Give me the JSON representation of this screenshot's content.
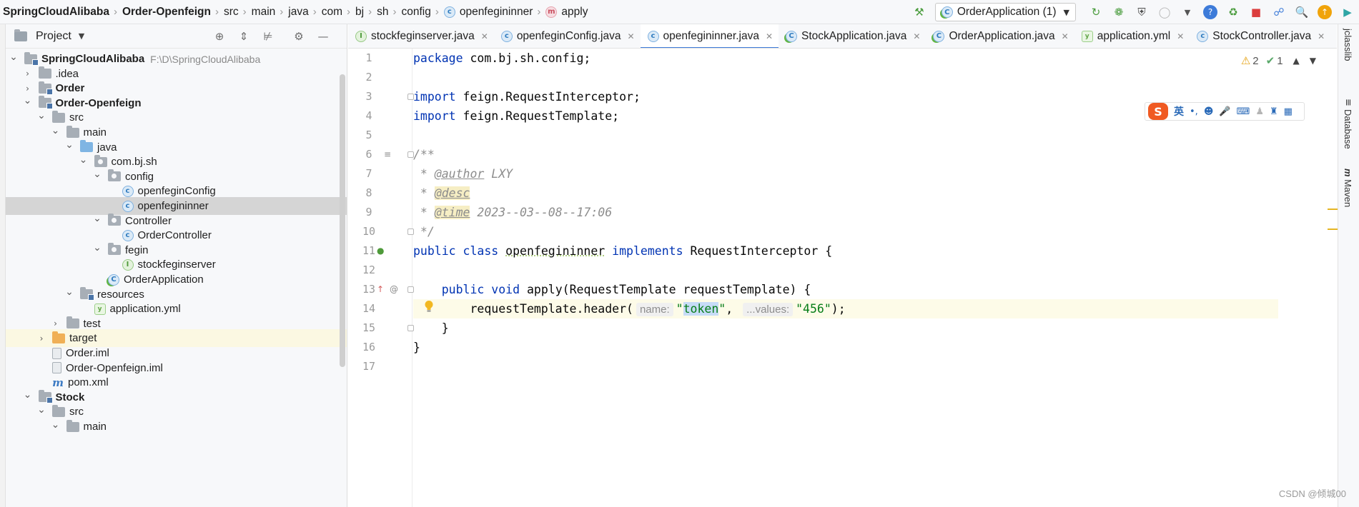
{
  "navbar": {
    "breadcrumbs": [
      {
        "label": "SpringCloudAlibaba",
        "bold": true
      },
      {
        "label": "Order-Openfeign",
        "bold": true
      },
      {
        "label": "src"
      },
      {
        "label": "main"
      },
      {
        "label": "java"
      },
      {
        "label": "com"
      },
      {
        "label": "bj"
      },
      {
        "label": "sh"
      },
      {
        "label": "config"
      },
      {
        "label": "openfegininner",
        "icon": "c"
      },
      {
        "label": "apply",
        "icon": "m"
      }
    ],
    "run_config": "OrderApplication (1)"
  },
  "project_panel": {
    "title": "Project",
    "tree": [
      {
        "label": "SpringCloudAlibaba",
        "bold": true,
        "path": "F:\\D\\SpringCloudAlibaba",
        "indent": 0,
        "chevron": "open",
        "icon": "module"
      },
      {
        "label": ".idea",
        "indent": 1,
        "chevron": "closed",
        "icon": "folder"
      },
      {
        "label": "Order",
        "bold": true,
        "indent": 1,
        "chevron": "closed",
        "icon": "module"
      },
      {
        "label": "Order-Openfeign",
        "bold": true,
        "indent": 1,
        "chevron": "open",
        "icon": "module"
      },
      {
        "label": "src",
        "indent": 2,
        "chevron": "open",
        "icon": "folder"
      },
      {
        "label": "main",
        "indent": 3,
        "chevron": "open",
        "icon": "folder"
      },
      {
        "label": "java",
        "indent": 4,
        "chevron": "open",
        "icon": "folder-blue"
      },
      {
        "label": "com.bj.sh",
        "indent": 5,
        "chevron": "open",
        "icon": "package"
      },
      {
        "label": "config",
        "indent": 6,
        "chevron": "open",
        "icon": "package"
      },
      {
        "label": "openfeginConfig",
        "indent": 7,
        "chevron": "none",
        "icon": "class"
      },
      {
        "label": "openfegininner",
        "indent": 7,
        "chevron": "none",
        "icon": "class",
        "selected": true
      },
      {
        "label": "Controller",
        "indent": 6,
        "chevron": "open",
        "icon": "package"
      },
      {
        "label": "OrderController",
        "indent": 7,
        "chevron": "none",
        "icon": "class"
      },
      {
        "label": "fegin",
        "indent": 6,
        "chevron": "open",
        "icon": "package"
      },
      {
        "label": "stockfeginserver",
        "indent": 7,
        "chevron": "none",
        "icon": "interface"
      },
      {
        "label": "OrderApplication",
        "indent": 6,
        "chevron": "none",
        "icon": "spring-class"
      },
      {
        "label": "resources",
        "indent": 4,
        "chevron": "open",
        "icon": "folder-res"
      },
      {
        "label": "application.yml",
        "indent": 5,
        "chevron": "none",
        "icon": "yml"
      },
      {
        "label": "test",
        "indent": 3,
        "chevron": "closed",
        "icon": "folder"
      },
      {
        "label": "target",
        "indent": 2,
        "chevron": "closed",
        "icon": "folder-orange",
        "highlight": true
      },
      {
        "label": "Order.iml",
        "indent": 2,
        "chevron": "none",
        "icon": "iml"
      },
      {
        "label": "Order-Openfeign.iml",
        "indent": 2,
        "chevron": "none",
        "icon": "iml"
      },
      {
        "label": "pom.xml",
        "indent": 2,
        "chevron": "none",
        "icon": "maven"
      },
      {
        "label": "Stock",
        "bold": true,
        "indent": 1,
        "chevron": "open",
        "icon": "module"
      },
      {
        "label": "src",
        "indent": 2,
        "chevron": "open",
        "icon": "folder"
      },
      {
        "label": "main",
        "indent": 3,
        "chevron": "open",
        "icon": "folder"
      }
    ]
  },
  "editor": {
    "tabs": [
      {
        "label": "stockfeginserver.java",
        "icon": "i"
      },
      {
        "label": "openfeginConfig.java",
        "icon": "c"
      },
      {
        "label": "openfegininner.java",
        "icon": "c",
        "active": true
      },
      {
        "label": "StockApplication.java",
        "icon": "app"
      },
      {
        "label": "OrderApplication.java",
        "icon": "app"
      },
      {
        "label": "application.yml",
        "icon": "yml"
      },
      {
        "label": "StockController.java",
        "icon": "c"
      }
    ],
    "line_numbers": [
      "1",
      "2",
      "3",
      "4",
      "5",
      "6",
      "7",
      "8",
      "9",
      "10",
      "11",
      "12",
      "13",
      "14",
      "15",
      "16",
      "17"
    ],
    "code": {
      "l1_kw": "package",
      "l1_rest": " com.bj.sh.config;",
      "import_kw": "import",
      "l3_rest": " feign.RequestInterceptor;",
      "l4_rest": " feign.RequestTemplate;",
      "l6": "/**",
      "l7_star": " * ",
      "l7_tag": "@author",
      "l7_val": " LXY",
      "l8_star": " * ",
      "l8_tag": "@desc",
      "l9_star": " * ",
      "l9_tag": "@time",
      "l9_val": " 2023--03--08--17:06",
      "l10": " */",
      "l11_kw1": "public",
      "l11_kw2": "class",
      "l11_name": "openfegininner",
      "l11_kw3": "implements",
      "l11_rest": " RequestInterceptor {",
      "l13_indent": "    ",
      "l13_kw1": "public",
      "l13_kw2": "void",
      "l13_rest": " apply(RequestTemplate requestTemplate) {",
      "l14_a": "        requestTemplate.header(",
      "l14_hint1": "name:",
      "l14_q1": "\"",
      "l14_token": "token",
      "l14_q2": "\"",
      "l14_comma": ", ",
      "l14_hint2": "...values:",
      "l14_val": "\"456\"",
      "l14_end": ");",
      "l15": "    }",
      "l16": "}"
    },
    "inspections": {
      "warnings": "2",
      "checks": "1"
    },
    "ime_label": "英"
  },
  "right_strip": {
    "tabs": [
      "jclasslib",
      "Database",
      "Maven"
    ]
  },
  "watermark": "CSDN @倾城00"
}
